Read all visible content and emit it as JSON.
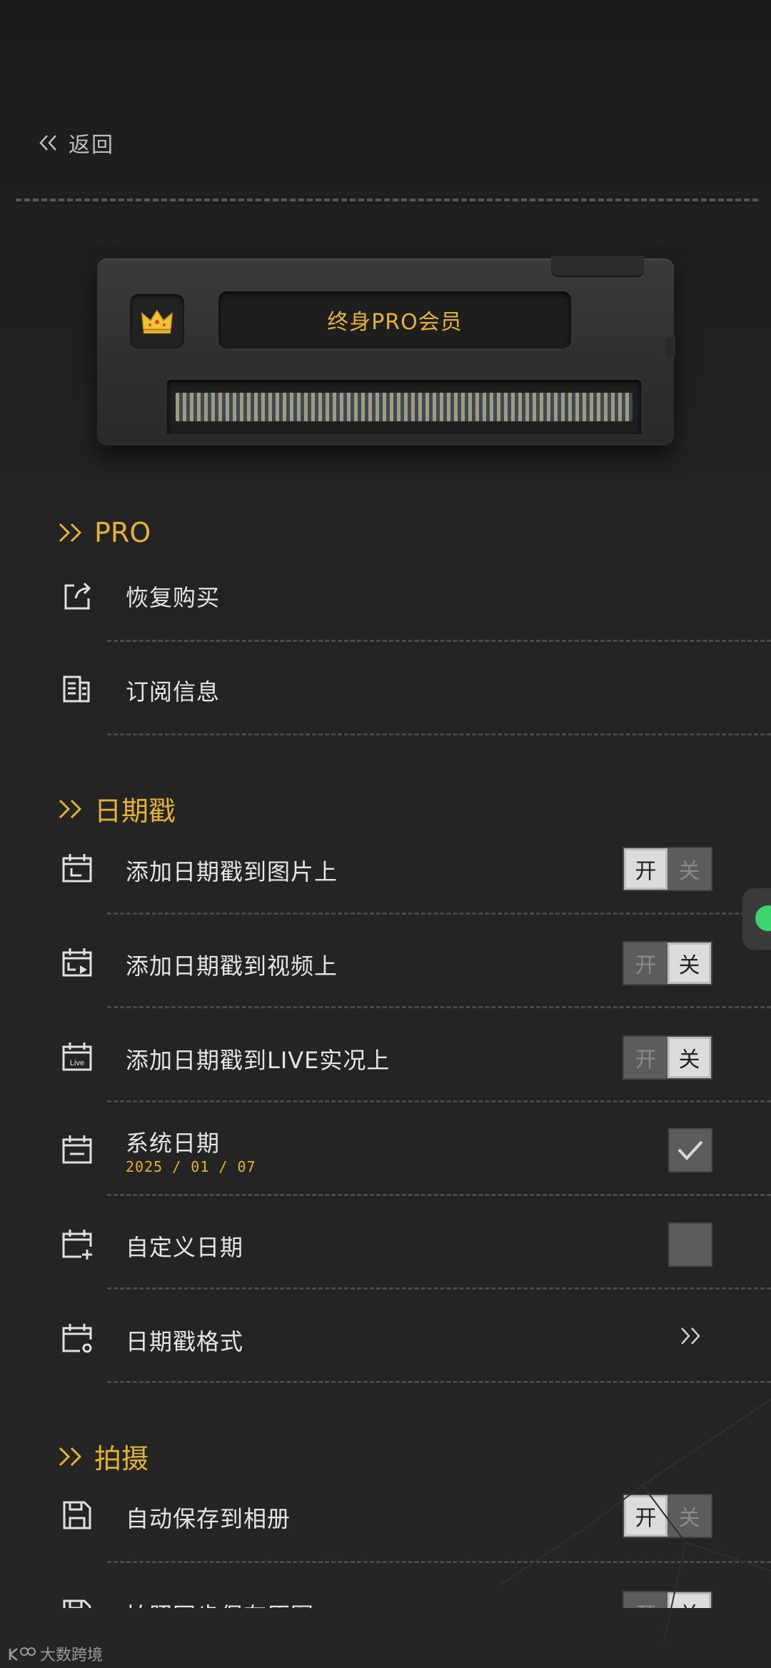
{
  "header": {
    "back_label": "返回"
  },
  "card": {
    "badge": "终身PRO会员"
  },
  "sections": {
    "pro": "PRO",
    "datestamp": "日期戳",
    "shooting": "拍摄"
  },
  "pro_items": {
    "restore": "恢复购买",
    "subscription": "订阅信息"
  },
  "toggle_labels": {
    "on": "开",
    "off": "关"
  },
  "datestamp_items": {
    "photo": {
      "label": "添加日期戳到图片上",
      "state": "on"
    },
    "video": {
      "label": "添加日期戳到视频上",
      "state": "off"
    },
    "live": {
      "label": "添加日期戳到LIVE实况上",
      "state": "off"
    },
    "system_date": {
      "label": "系统日期",
      "value": "2025 / 01 / 07",
      "checked": true
    },
    "custom_date": {
      "label": "自定义日期",
      "checked": false
    },
    "format": {
      "label": "日期戳格式"
    }
  },
  "shooting_items": {
    "auto_save": {
      "label": "自动保存到相册",
      "state": "on"
    },
    "partial": {
      "label": "拍照同步保存原图"
    }
  },
  "watermark": {
    "text": "大数跨境"
  },
  "colors": {
    "accent": "#e4b233",
    "background": "#232323",
    "toggle_active": "#dcdcdc"
  },
  "icons": {
    "back": "double-chevron-left-icon",
    "restore": "share-out-icon",
    "subscription": "document-list-icon",
    "calendar": "calendar-icon",
    "save": "floppy-disk-icon",
    "crown": "crown-icon"
  }
}
